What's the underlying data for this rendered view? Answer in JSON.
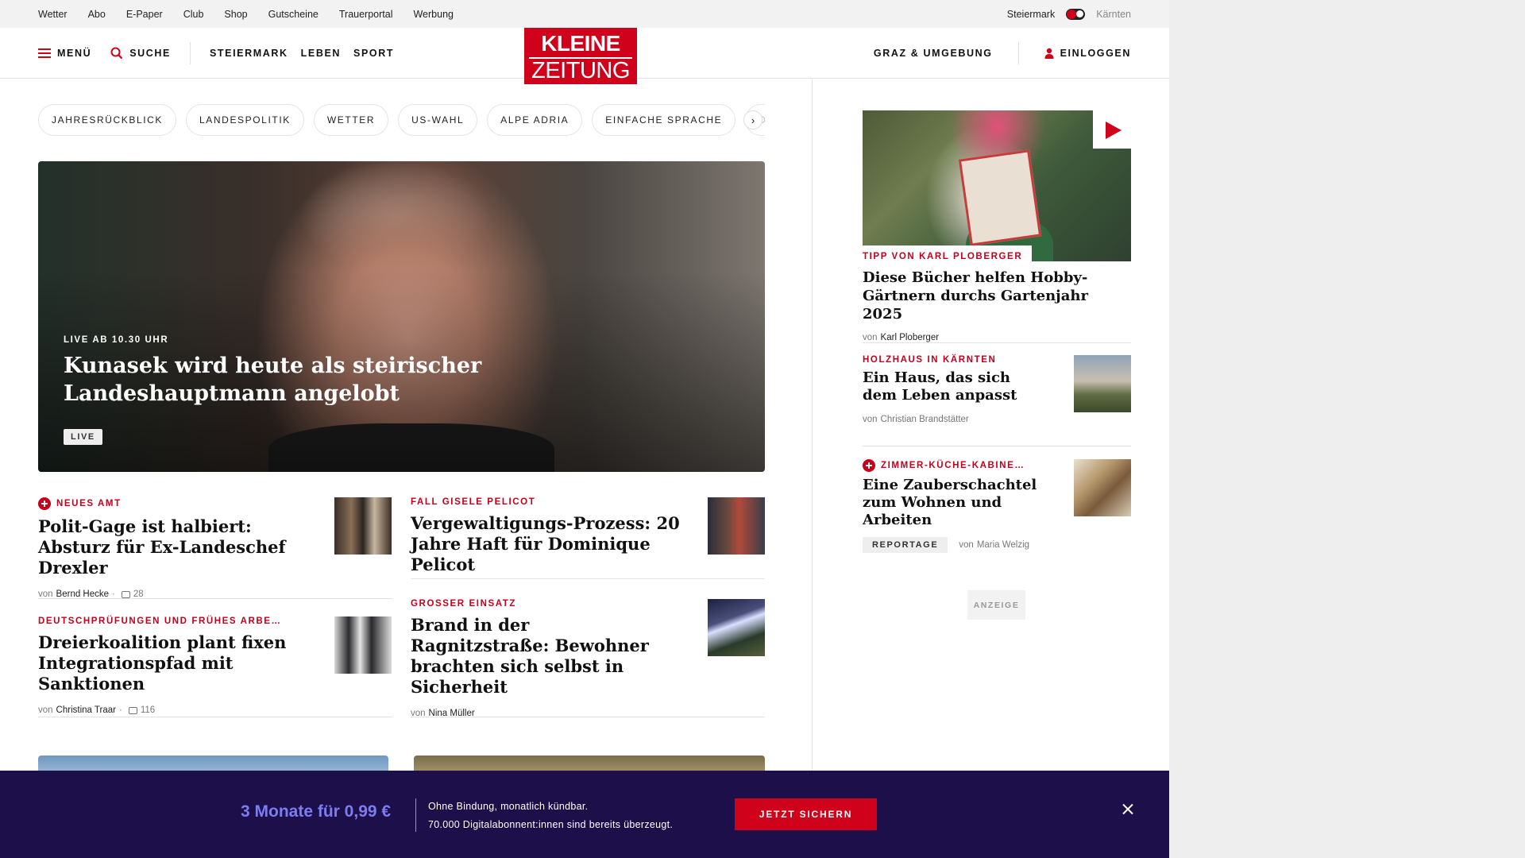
{
  "topbar": {
    "links": [
      "Wetter",
      "Abo",
      "E-Paper",
      "Club",
      "Shop",
      "Gutscheine",
      "Trauerportal",
      "Werbung"
    ],
    "region_active": "Steiermark",
    "region_inactive": "Kärnten"
  },
  "header": {
    "menu_label": "MENÜ",
    "search_label": "SUCHE",
    "nav": [
      "STEIERMARK",
      "LEBEN",
      "SPORT"
    ],
    "logo_line1": "KLEINE",
    "logo_line2": "ZEITUNG",
    "local_label": "GRAZ & UMGEBUNG",
    "login_label": "EINLOGGEN"
  },
  "chips": [
    "JAHRESRÜCKBLICK",
    "LANDESPOLITIK",
    "WETTER",
    "US-WAHL",
    "ALPE ADRIA",
    "EINFACHE SPRACHE",
    "DO"
  ],
  "hero": {
    "kicker": "LIVE AB 10.30 UHR",
    "headline": "Kunasek wird heute als steirischer Landeshauptmann angelobt",
    "badge": "LIVE"
  },
  "articles": [
    {
      "kicker": "NEUES AMT",
      "headline": "Polit-Gage ist halbiert: Absturz für Ex-Landeschef Drexler",
      "by": "von",
      "author": "Bernd Hecke",
      "comments": "28"
    },
    {
      "kicker": "FALL GISELE PELICOT",
      "headline": "Vergewaltigungs-Prozess: 20 Jahre Haft für Dominique Pelicot"
    },
    {
      "kicker": "DEUTSCHPRÜFUNGEN UND FRÜHES ARBE…",
      "headline": "Dreierkoalition plant fixen Integrationspfad mit Sanktionen",
      "by": "von",
      "author": "Christina Traar",
      "comments": "116"
    },
    {
      "kicker": "GROSSER EINSATZ",
      "headline": "Brand in der Ragnitzstraße: Bewohner brachten sich selbst in Sicherheit",
      "by": "von",
      "author": "Nina Müller"
    }
  ],
  "sidebar": {
    "feature": {
      "kicker": "TIPP VON KARL PLOBERGER",
      "headline": "Diese Bücher helfen Hobby-Gärtnern durchs Gartenjahr 2025",
      "by": "von",
      "author": "Karl Ploberger"
    },
    "items": [
      {
        "kicker": "HOLZHAUS IN KÄRNTEN",
        "headline": "Ein Haus, das sich dem Leben anpasst",
        "by": "von",
        "author": "Christian Brandstätter"
      },
      {
        "kicker": "ZIMMER-KÜCHE-KABINE…",
        "headline": "Eine Zauberschachtel zum Wohnen und Arbeiten",
        "badge": "REPORTAGE",
        "by": "von",
        "author": "Maria Welzig"
      }
    ],
    "ad_label": "ANZEIGE"
  },
  "promo": {
    "price": "3 Monate für 0,99 €",
    "line1": "Ohne Bindung, monatlich kündbar.",
    "line2": "70.000 Digitalabonnent:innen sind bereits überzeugt.",
    "cta": "JETZT SICHERN"
  },
  "colors": {
    "brand": "#d0021b",
    "kicker": "#c4001a",
    "promo_bg": "#1c0f4a",
    "promo_price": "#7d7cf0"
  }
}
